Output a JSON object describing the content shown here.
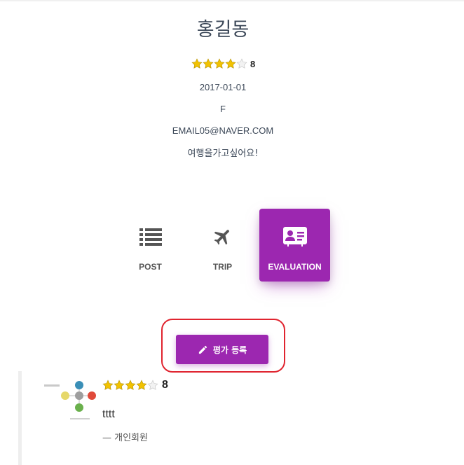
{
  "profile": {
    "name": "홍길동",
    "rating": {
      "stars_filled": 4,
      "stars_total": 5,
      "score": "8"
    },
    "birthdate": "2017-01-01",
    "gender": "F",
    "email": "EMAIL05@NAVER.COM",
    "intro": "여행을가고싶어요!"
  },
  "tabs": [
    {
      "label": "POST",
      "icon": "list-icon",
      "active": false
    },
    {
      "label": "TRIP",
      "icon": "airplane-icon",
      "active": false
    },
    {
      "label": "EVALUATION",
      "icon": "id-card-icon",
      "active": true
    }
  ],
  "evaluation_button": {
    "label": "평가 등록",
    "icon": "pencil-icon"
  },
  "colors": {
    "accent": "#9c27b0",
    "highlight": "#e0242f",
    "star": "#f2c200"
  },
  "reviews": [
    {
      "thumbnail": "diagram-thumbnail",
      "rating": {
        "stars_filled": 4,
        "stars_total": 5,
        "score": "8"
      },
      "text": "tttt",
      "author": "— 개인회원"
    }
  ]
}
